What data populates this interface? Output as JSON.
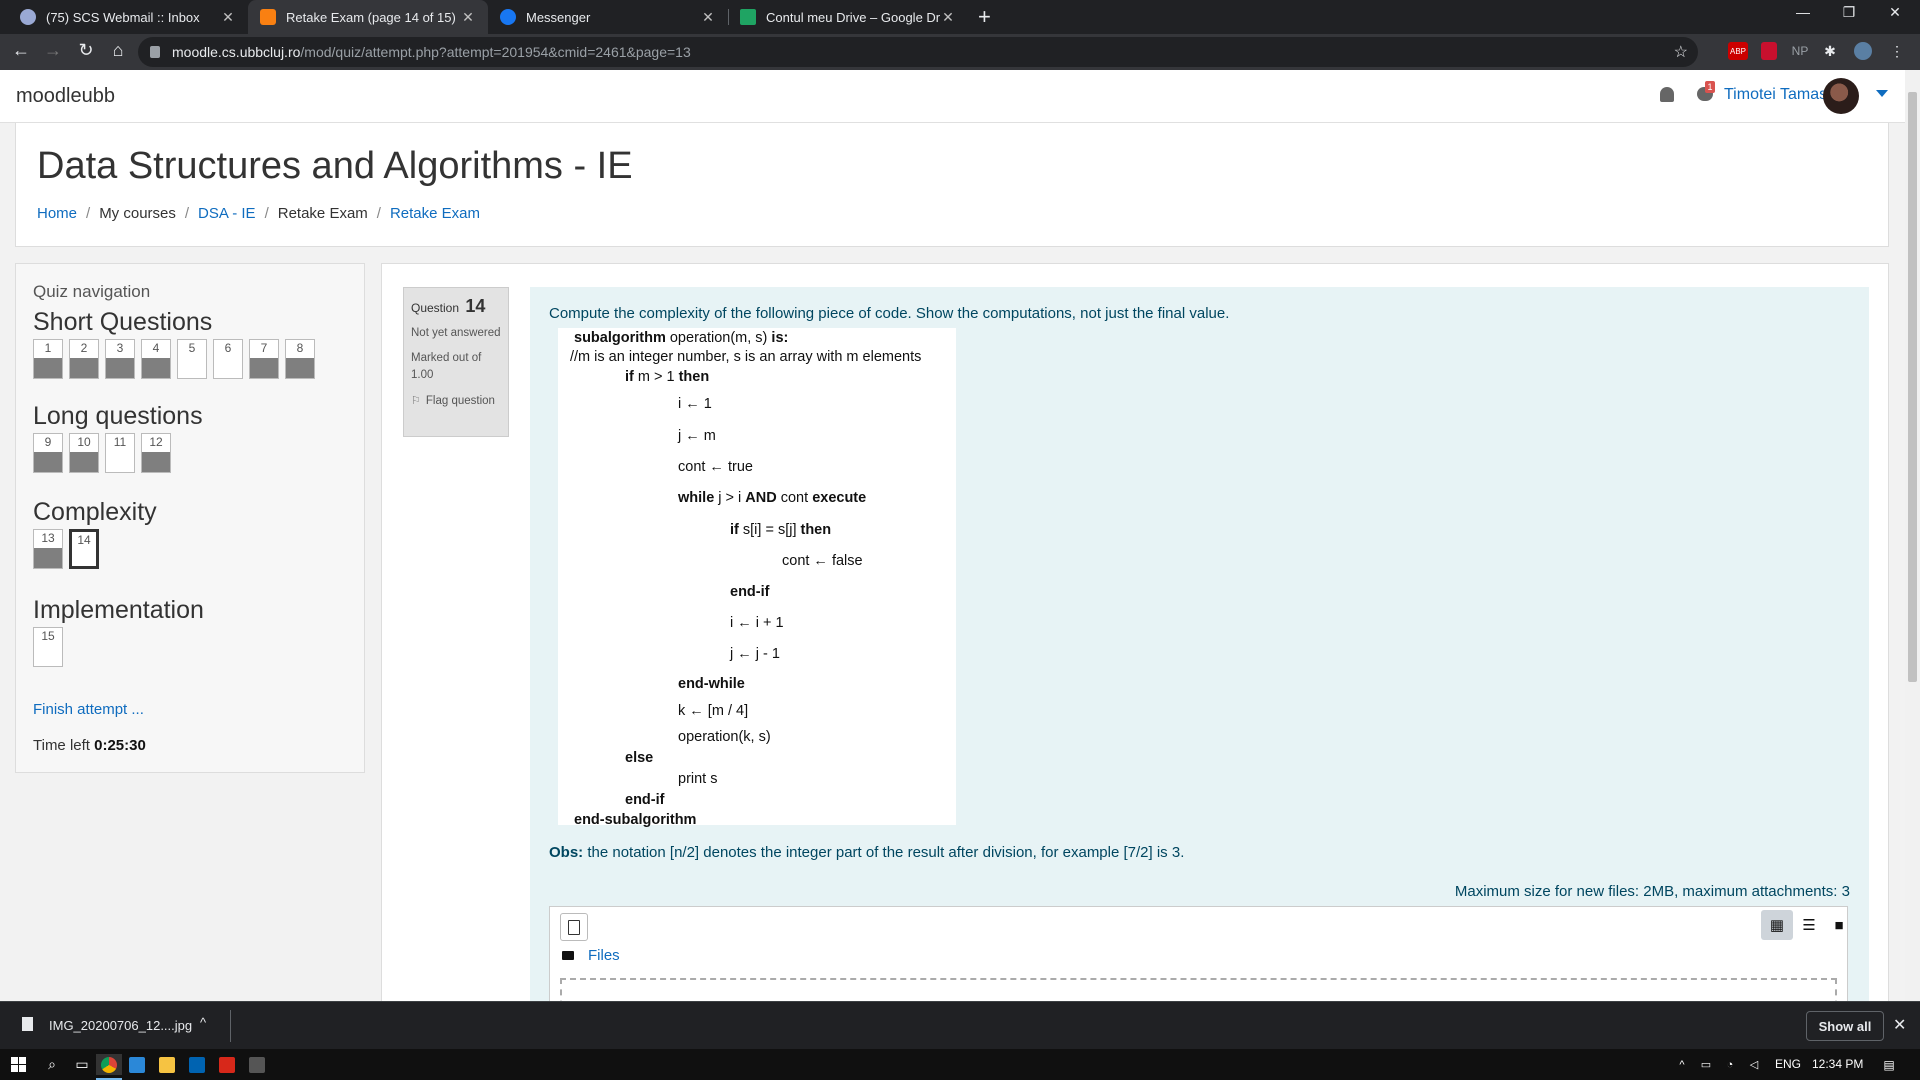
{
  "browser": {
    "tabs": [
      {
        "title": "(75) SCS Webmail :: Inbox",
        "favicon_color": "#9aa9d4"
      },
      {
        "title": "Retake Exam (page 14 of 15)",
        "favicon_color": "#f98012"
      },
      {
        "title": "Messenger",
        "favicon_color": "#1877f2"
      },
      {
        "title": "Contul meu Drive – Google Drive",
        "favicon_color": "#1fa463"
      }
    ],
    "url_host": "moodle.cs.ubbcluj.ro",
    "url_path": "/mod/quiz/attempt.php?attempt=201954&cmid=2461&page=13",
    "extensions": [
      "ABP",
      "NP"
    ]
  },
  "header": {
    "brand": "moodleubb",
    "notification_count": "1",
    "username": "Timotei Tamas"
  },
  "course": {
    "title": "Data Structures and Algorithms - IE",
    "breadcrumb": [
      "Home",
      "My courses",
      "DSA - IE",
      "Retake Exam",
      "Retake Exam"
    ]
  },
  "quiz_nav": {
    "title": "Quiz navigation",
    "sections": [
      {
        "heading": "Short Questions",
        "questions": [
          {
            "num": "1",
            "answered": true
          },
          {
            "num": "2",
            "answered": true
          },
          {
            "num": "3",
            "answered": true
          },
          {
            "num": "4",
            "answered": true
          },
          {
            "num": "5",
            "answered": false
          },
          {
            "num": "6",
            "answered": false
          },
          {
            "num": "7",
            "answered": true
          },
          {
            "num": "8",
            "answered": true
          }
        ]
      },
      {
        "heading": "Long questions",
        "questions": [
          {
            "num": "9",
            "answered": true
          },
          {
            "num": "10",
            "answered": true
          },
          {
            "num": "11",
            "answered": false
          },
          {
            "num": "12",
            "answered": true
          }
        ]
      },
      {
        "heading": "Complexity",
        "questions": [
          {
            "num": "13",
            "answered": true
          },
          {
            "num": "14",
            "answered": false,
            "current": true
          }
        ]
      },
      {
        "heading": "Implementation",
        "questions": [
          {
            "num": "15",
            "answered": false
          }
        ]
      }
    ],
    "finish": "Finish attempt ...",
    "time_left_label": "Time left",
    "time_left": "0:25:30"
  },
  "question": {
    "label": "Question",
    "number": "14",
    "state": "Not yet answered",
    "grade": "Marked out of 1.00",
    "flag": "Flag question",
    "prompt": "Compute the complexity of the following piece of code. Show the computations, not just the final value.",
    "code": [
      {
        "b": "subalgorithm",
        "t": " operation(m, s) ",
        "b2": "is:"
      },
      {
        "t": "//m is an integer number, s is an array with m elements"
      },
      {
        "b": "if",
        "t": " m > 1 ",
        "b2": "then"
      },
      {
        "t": "i ← 1"
      },
      {
        "t": "j ← m"
      },
      {
        "t": "cont ← true"
      },
      {
        "b": "while",
        "t": " j >  i ",
        "b2": "AND",
        "t2": " cont ",
        "b3": "execute"
      },
      {
        "b": "if",
        "t": " s[i] = s[j] ",
        "b2": "then"
      },
      {
        "t": "cont ← false"
      },
      {
        "b": "end-if"
      },
      {
        "t": "i ← i + 1"
      },
      {
        "t": "j ← j - 1"
      },
      {
        "b": "end-while"
      },
      {
        "t": "k ← [m / 4]"
      },
      {
        "t": "operation(k, s)"
      },
      {
        "b": "else"
      },
      {
        "t": "print s"
      },
      {
        "b": "end-if"
      },
      {
        "b": "end-subalgorithm"
      }
    ],
    "obs_label": "Obs:",
    "obs_text": " the notation [n/2] denotes the integer part of the result after division, for example [7/2] is 3.",
    "max_size": "Maximum size for new files: 2MB, maximum attachments: 3",
    "files_label": "Files"
  },
  "downloads": {
    "file": "IMG_20200706_12....jpg",
    "show_all": "Show all"
  },
  "taskbar": {
    "lang": "ENG",
    "time": "12:34 PM"
  }
}
